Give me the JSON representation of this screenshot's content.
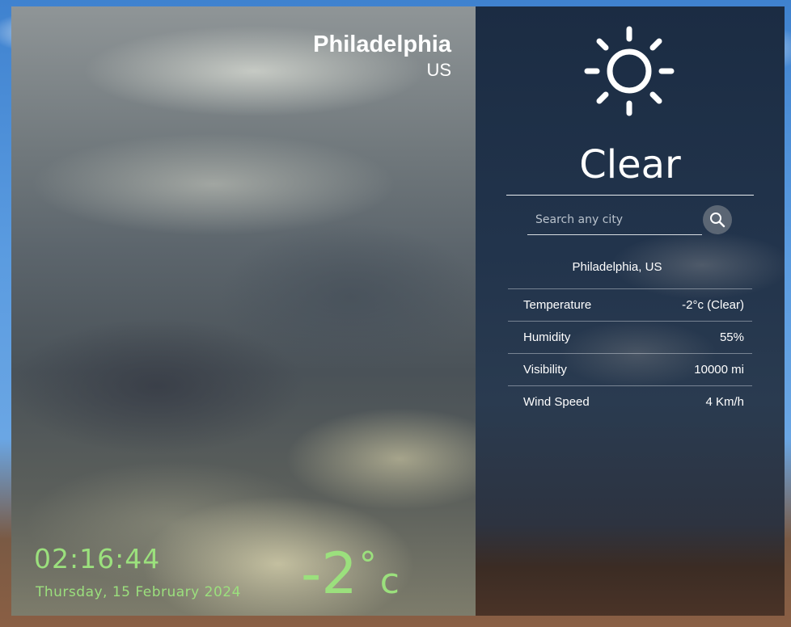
{
  "location": {
    "city": "Philadelphia",
    "country": "US",
    "full": "Philadelphia, US"
  },
  "clock": {
    "time": "02:16:44",
    "date": "Thursday, 15 February 2024"
  },
  "current": {
    "temp_value": "-2",
    "degree_symbol": "°",
    "unit": "c",
    "condition": "Clear",
    "icon": "sun-icon"
  },
  "search": {
    "placeholder": "Search any city",
    "icon": "search-icon"
  },
  "details": [
    {
      "label": "Temperature",
      "value": "-2°c (Clear)"
    },
    {
      "label": "Humidity",
      "value": "55%"
    },
    {
      "label": "Visibility",
      "value": "10000 mi"
    },
    {
      "label": "Wind Speed",
      "value": "4 Km/h"
    }
  ],
  "colors": {
    "accent_green": "#9be07d",
    "panel_bg": "#22344c",
    "text": "#ffffff"
  }
}
